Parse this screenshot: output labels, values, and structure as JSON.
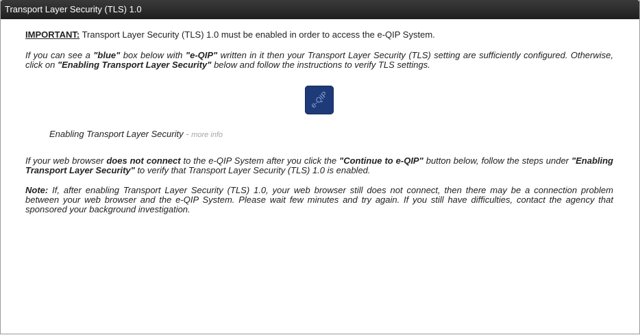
{
  "header": {
    "title": "Transport Layer Security (TLS) 1.0"
  },
  "important": {
    "label": "IMPORTANT:",
    "text": " Transport Layer Security (TLS) 1.0 must be enabled in order to access the e-QIP System."
  },
  "para1": {
    "t1": "If you can see a ",
    "b1": "\"blue\"",
    "t2": " box below with ",
    "b2": "\"e-QIP\"",
    "t3": " written in it then your Transport Layer Security (TLS) setting are sufficiently configured. Otherwise, click on ",
    "b3": "\"Enabling Transport Layer Security\"",
    "t4": " below and follow the instructions to verify TLS settings."
  },
  "badge": {
    "text": "e-QIP",
    "color": "#1f3a78"
  },
  "link": {
    "label": "Enabling Transport Layer Security",
    "separator": " - ",
    "more": "more info"
  },
  "para2": {
    "t1": "If your web browser ",
    "b1": "does not connect",
    "t2": " to the e-QIP System after you click the ",
    "b2": "\"Continue to e-QIP\"",
    "t3": " button below, follow the steps under ",
    "b3": "\"Enabling Transport Layer Security\"",
    "t4": " to verify that Transport Layer Security (TLS) 1.0 is enabled."
  },
  "para3": {
    "label": "Note:",
    "text": " If, after enabling Transport Layer Security (TLS) 1.0, your web browser still does not connect, then there may be a connection problem between your web browser and the e-QIP System. Please wait few minutes and try again. If you still have difficulties, contact the agency that sponsored your background investigation."
  }
}
